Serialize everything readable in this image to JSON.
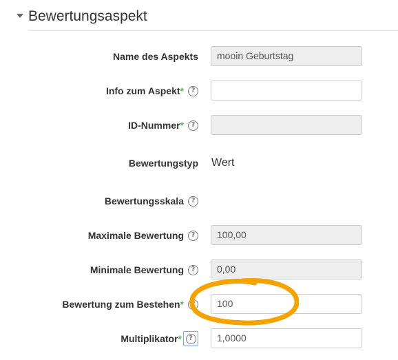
{
  "section": {
    "title": "Bewertungsaspekt"
  },
  "fields": {
    "name": {
      "label": "Name des Aspekts",
      "value": "mooin Geburtstag"
    },
    "info": {
      "label": "Info zum Aspekt",
      "required_mark": "*",
      "help": "?",
      "value": ""
    },
    "idnumber": {
      "label": "ID-Nummer",
      "required_mark": "*",
      "help": "?",
      "value": ""
    },
    "gradetype": {
      "label": "Bewertungstyp",
      "help": "?",
      "value": "Wert"
    },
    "scale": {
      "label": "Bewertungsskala",
      "help": "?"
    },
    "grademax": {
      "label": "Maximale Bewertung",
      "help": "?",
      "value": "100,00"
    },
    "grademin": {
      "label": "Minimale Bewertung",
      "help": "?",
      "value": "0,00"
    },
    "gradepass": {
      "label": "Bewertung zum Bestehen",
      "required_mark": "*",
      "help": "?",
      "value": "100"
    },
    "multiplicator": {
      "label": "Multiplikator",
      "required_mark": "*",
      "help": "?",
      "value": "1,0000"
    }
  },
  "colors": {
    "highlight": "#f5a300",
    "required": "#5cb85c"
  }
}
